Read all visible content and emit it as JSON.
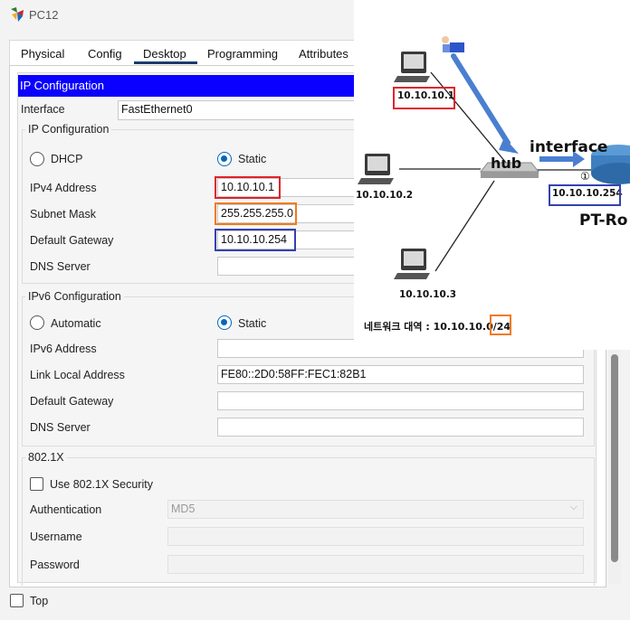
{
  "window": {
    "title": "PC12"
  },
  "tabs": [
    {
      "label": "Physical"
    },
    {
      "label": "Config"
    },
    {
      "label": "Desktop"
    },
    {
      "label": "Programming"
    },
    {
      "label": "Attributes"
    }
  ],
  "active_tab": "Desktop",
  "ip_config": {
    "header": "IP Configuration",
    "interface_label": "Interface",
    "interface_value": "FastEthernet0",
    "ipv4_group": {
      "title": "IP Configuration",
      "dhcp_label": "DHCP",
      "static_label": "Static",
      "selected": "Static",
      "ipv4_label": "IPv4 Address",
      "ipv4_value": "10.10.10.1",
      "mask_label": "Subnet Mask",
      "mask_value": "255.255.255.0",
      "gateway_label": "Default Gateway",
      "gateway_value": "10.10.10.254",
      "dns_label": "DNS Server",
      "dns_value": ""
    },
    "ipv6_group": {
      "title": "IPv6 Configuration",
      "automatic_label": "Automatic",
      "static_label": "Static",
      "selected": "Static",
      "ipv6_label": "IPv6 Address",
      "ipv6_value": "",
      "link_local_label": "Link Local Address",
      "link_local_value": "FE80::2D0:58FF:FEC1:82B1",
      "gateway_label": "Default Gateway",
      "gateway_value": "",
      "dns_label": "DNS Server",
      "dns_value": ""
    },
    "dot1x_group": {
      "title": "802.1X",
      "use_label": "Use 802.1X Security",
      "use_checked": false,
      "auth_label": "Authentication",
      "auth_value": "MD5",
      "username_label": "Username",
      "username_value": "",
      "password_label": "Password",
      "password_value": ""
    }
  },
  "footer": {
    "top_label": "Top",
    "top_checked": false
  },
  "diagram": {
    "pc1_ip": "10.10.10.1",
    "pc2_ip": "10.10.10.2",
    "pc3_ip": "10.10.10.3",
    "hub_label": "hub",
    "interface_label": "interface",
    "marker": "①",
    "router_ip": "10.10.10.254",
    "router_label": "PT-Ro",
    "network_label": "네트워크 대역 : 10.10.10.0",
    "network_prefix": "/24"
  },
  "highlight_colors": {
    "red": "#e0232c",
    "orange": "#f07a1a",
    "blue": "#3442b0",
    "header_blue": "#0a00ff"
  }
}
